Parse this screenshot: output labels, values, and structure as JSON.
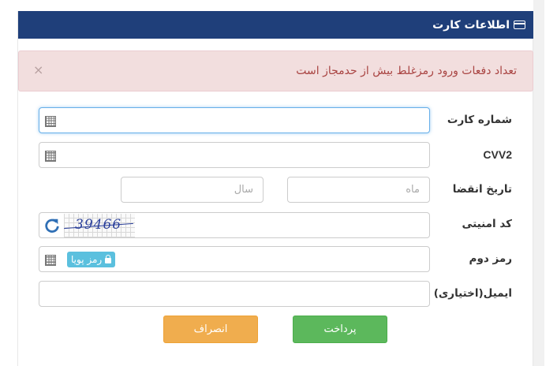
{
  "header": {
    "title": "اطلاعات کارت",
    "icon": "credit-card-icon",
    "bg": "#1f3f7a"
  },
  "alert": {
    "message": "تعداد دفعات ورود رمزغلط بیش از حدمجاز است",
    "close": "×"
  },
  "form": {
    "card_number_label": "شماره کارت",
    "cvv2_label": "CVV2",
    "expiry_label": "تاریخ انقضا",
    "month_placeholder": "ماه",
    "year_placeholder": "سال",
    "captcha_label": "کد امنیتی",
    "captcha_text": "39466",
    "pin2_label": "رمز دوم",
    "dynamic_pin_button": "رمز پویا",
    "email_label": "ایمیل(اختیاری)"
  },
  "buttons": {
    "pay": "پرداخت",
    "cancel": "انصراف",
    "pay_color": "#5cb85c",
    "cancel_color": "#f0ad4e"
  }
}
